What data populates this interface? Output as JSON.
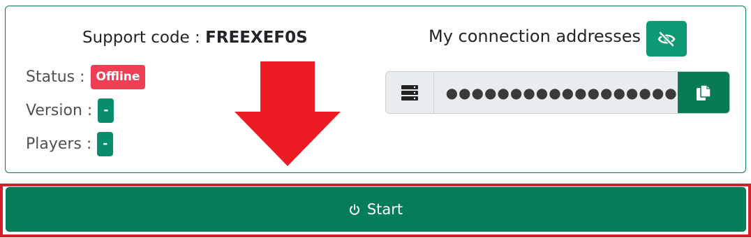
{
  "support": {
    "label": "Support code :",
    "code": "FREEXEF0S"
  },
  "status": {
    "label": "Status :",
    "value": "Offline",
    "color": "#ef3f55"
  },
  "version": {
    "label": "Version :",
    "value": "-"
  },
  "players": {
    "label": "Players :",
    "value": "-"
  },
  "connection": {
    "title": "My connection addresses",
    "address_masked": "●●●●●●●●●●●●●●●●●●",
    "toggle_icon": "eye-slash-icon",
    "server_icon": "server-icon",
    "copy_icon": "copy-icon"
  },
  "start": {
    "label": "Start",
    "icon": "power-icon"
  },
  "colors": {
    "accent": "#047d58",
    "danger": "#ef3f55",
    "highlight": "#d61f2a"
  }
}
